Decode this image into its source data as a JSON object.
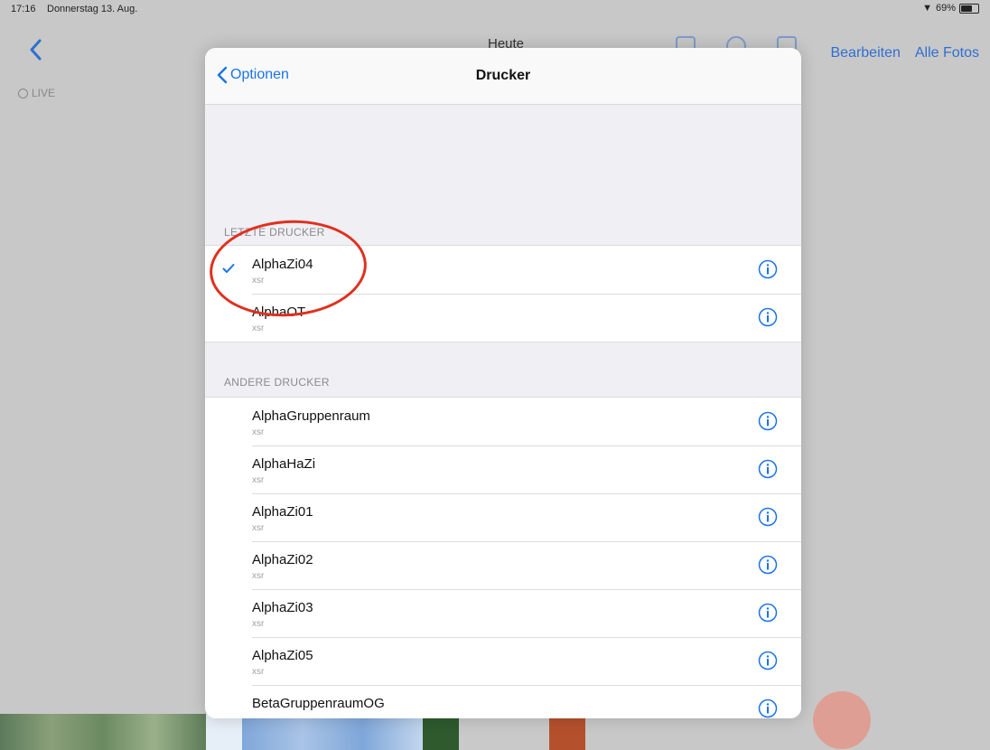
{
  "status_bar": {
    "time": "17:16",
    "date": "Donnerstag 13. Aug.",
    "battery": "69%"
  },
  "background": {
    "title": "Heute",
    "edit_label": "Bearbeiten",
    "all_photos_label": "Alle Fotos",
    "live_label": "LIVE"
  },
  "sheet": {
    "back_label": "Optionen",
    "title": "Drucker",
    "recent_header": "LETZTE DRUCKER",
    "other_header": "ANDERE DRUCKER",
    "recent_printers": [
      {
        "name": "AlphaZi04",
        "subtitle": "xsr",
        "selected": true
      },
      {
        "name": "AlphaOT",
        "subtitle": "xsr",
        "selected": false
      }
    ],
    "other_printers": [
      {
        "name": "AlphaGruppenraum",
        "subtitle": "xsr"
      },
      {
        "name": "AlphaHaZi",
        "subtitle": "xsr"
      },
      {
        "name": "AlphaZi01",
        "subtitle": "xsr"
      },
      {
        "name": "AlphaZi02",
        "subtitle": "xsr"
      },
      {
        "name": "AlphaZi03",
        "subtitle": "xsr"
      },
      {
        "name": "AlphaZi05",
        "subtitle": "xsr"
      },
      {
        "name": "BetaGruppenraumOG",
        "subtitle": ""
      }
    ]
  },
  "colors": {
    "accent": "#1a74e8",
    "annotation": "#e0301e",
    "sheet_bg": "#efeff4"
  }
}
